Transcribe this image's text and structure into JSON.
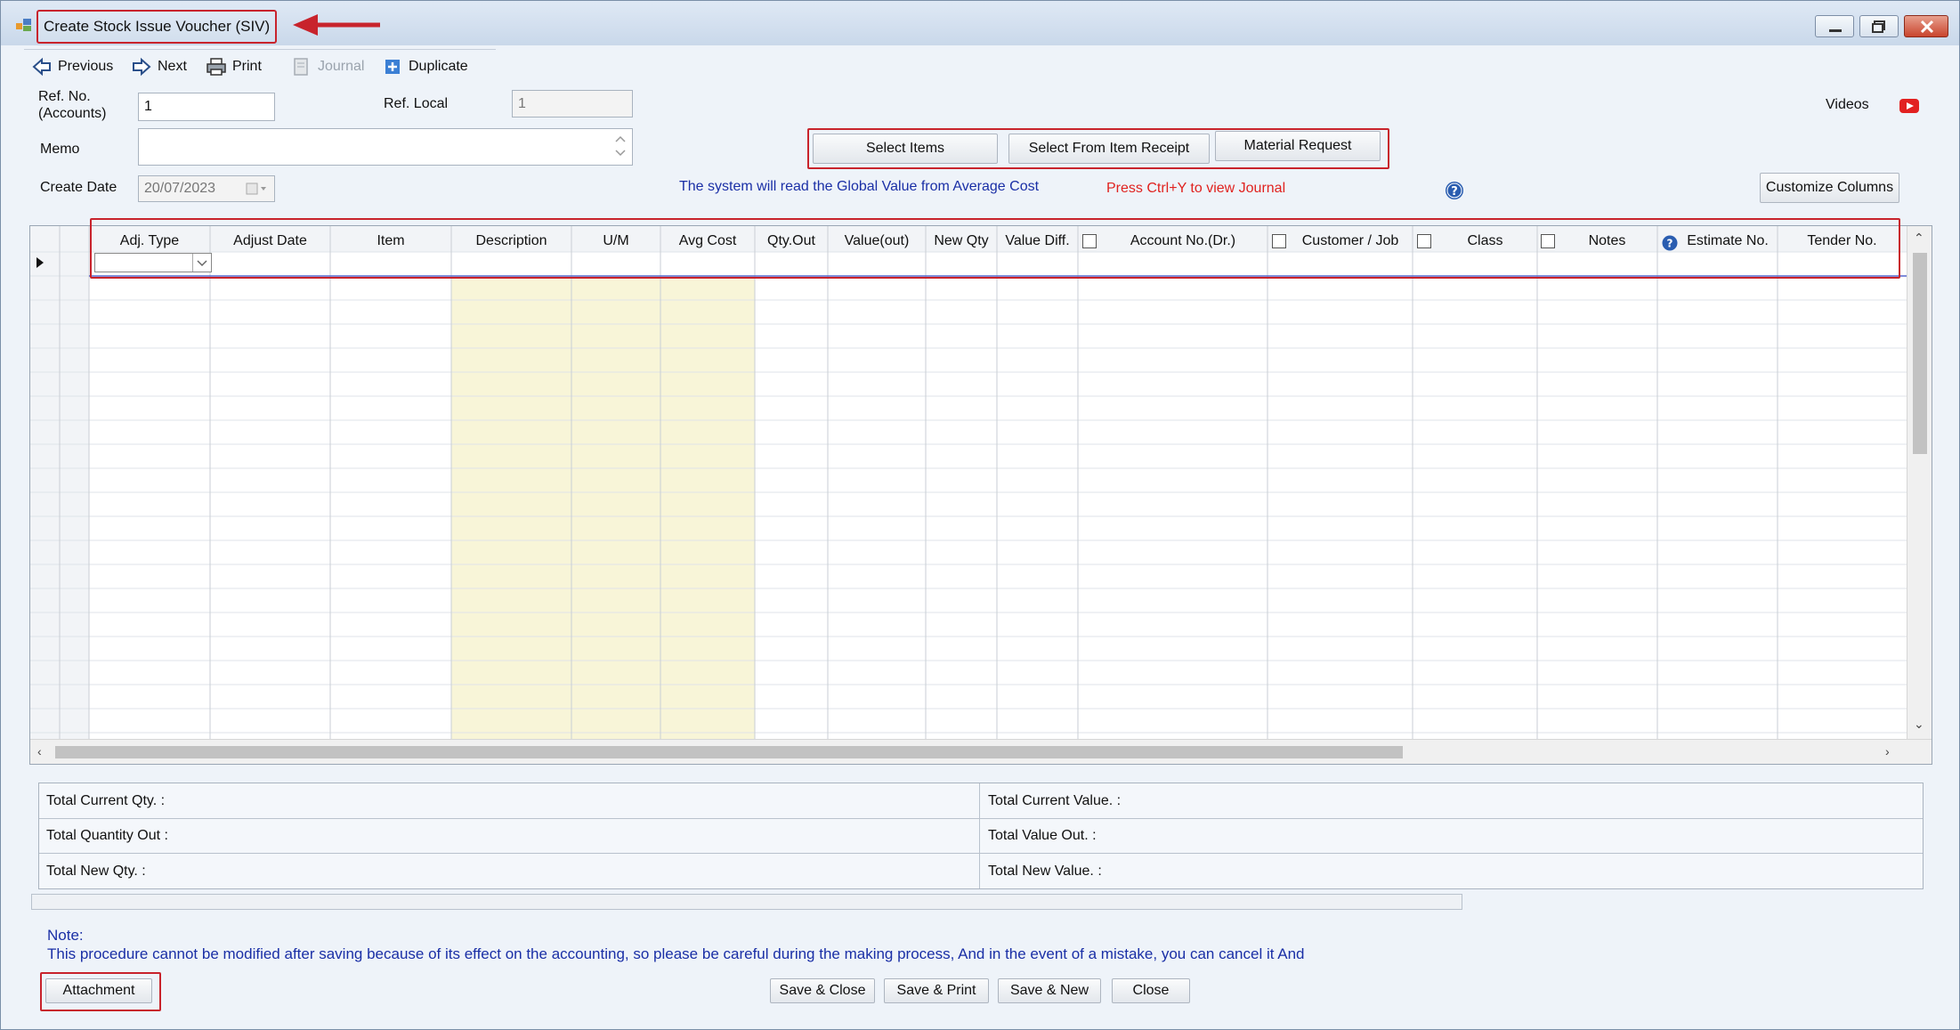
{
  "window": {
    "title": "Create Stock Issue Voucher (SIV)"
  },
  "toolbar": {
    "previous": "Previous",
    "next": "Next",
    "print": "Print",
    "journal": "Journal",
    "duplicate": "Duplicate"
  },
  "form": {
    "ref_no_label_line1": "Ref. No.",
    "ref_no_label_line2": "(Accounts)",
    "ref_no_value": "1",
    "ref_local_label": "Ref. Local",
    "ref_local_value": "1",
    "memo_label": "Memo",
    "memo_value": "",
    "create_date_label": "Create Date",
    "create_date_value": "20/07/2023"
  },
  "actions": {
    "select_items": "Select Items",
    "select_from_receipt": "Select From Item Receipt",
    "material_request": "Material Request",
    "customize_columns": "Customize Columns"
  },
  "info": {
    "global_value_msg": "The system will read the Global Value from Average Cost",
    "journal_hint": "Press Ctrl+Y to view Journal",
    "videos_label": "Videos"
  },
  "grid": {
    "columns": [
      "Adj. Type",
      "Adjust Date",
      "Item",
      "Description",
      "U/M",
      "Avg Cost",
      "Qty.Out",
      "Value(out)",
      "New Qty",
      "Value Diff.",
      "Account No.(Dr.)",
      "Customer / Job",
      "Class",
      "Notes",
      "Estimate No.",
      "Tender No."
    ],
    "rows_visible": 20
  },
  "totals": {
    "current_qty": "Total Current Qty. :",
    "quantity_out": "Total Quantity Out :",
    "new_qty": "Total New Qty. :",
    "current_value": "Total Current Value. :",
    "value_out": "Total Value Out. :",
    "new_value": "Total New Value. :"
  },
  "note": {
    "title": "Note:",
    "body": "This procedure cannot be modified after saving because of its effect on the accounting, so please be careful during the making process, And in the event of a mistake, you can cancel it And"
  },
  "footer": {
    "attachment": "Attachment",
    "save_close": "Save & Close",
    "save_print": "Save & Print",
    "save_new": "Save & New",
    "close": "Close"
  },
  "colors": {
    "highlight_red": "#c8232c",
    "info_blue": "#1a2fa6",
    "hint_red": "#e0221f",
    "readonly_column": "#f8f5d8"
  }
}
